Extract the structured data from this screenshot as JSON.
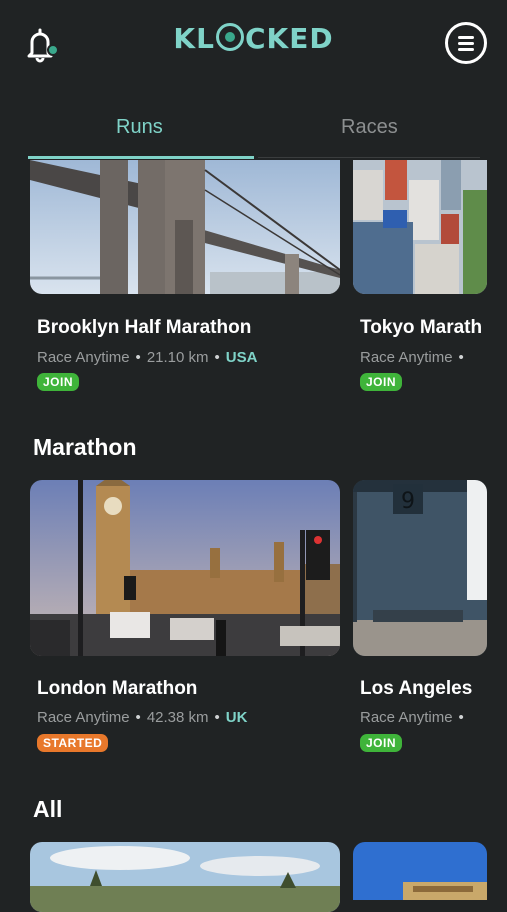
{
  "header": {
    "logo_text_pre": "KL",
    "logo_text_post": "CKED",
    "icons": {
      "left": "bell-icon",
      "right": "menu-icon"
    },
    "accent": "#7fd3c8"
  },
  "tabs": [
    {
      "label": "Runs",
      "active": true
    },
    {
      "label": "Races",
      "active": false
    }
  ],
  "featured": [
    {
      "title": "Brooklyn Half Marathon",
      "type": "Race Anytime",
      "distance": "21.10 km",
      "country": "USA",
      "status": "JOIN"
    },
    {
      "title": "Tokyo Marath",
      "type": "Race Anytime",
      "distance": "",
      "country": "",
      "status": "JOIN"
    }
  ],
  "sections": [
    {
      "title": "Marathon",
      "cards": [
        {
          "title": "London Marathon",
          "type": "Race Anytime",
          "distance": "42.38 km",
          "country": "UK",
          "status": "STARTED"
        },
        {
          "title": "Los Angeles",
          "type": "Race Anytime",
          "distance": "",
          "country": "",
          "status": "JOIN"
        }
      ]
    },
    {
      "title": "All",
      "cards": []
    }
  ],
  "colors": {
    "join": "#3fb43a",
    "started": "#e8782b",
    "background": "#202324"
  }
}
